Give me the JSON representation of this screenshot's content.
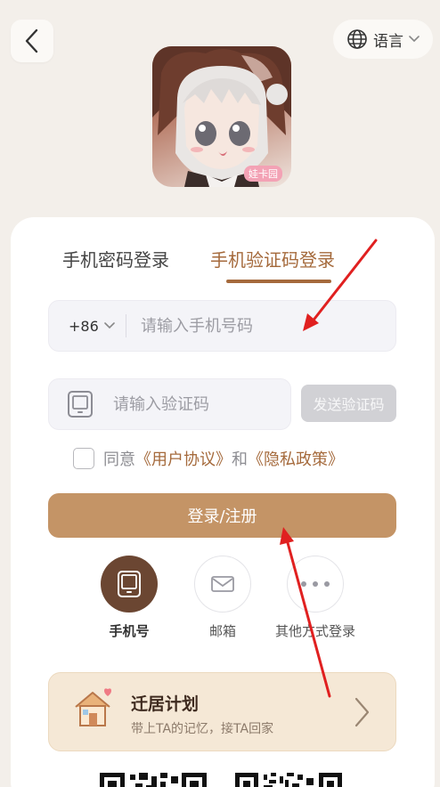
{
  "header": {
    "language_label": "语言"
  },
  "avatar": {
    "watermark": "娃卡园"
  },
  "tabs": [
    {
      "label": "手机密码登录",
      "active": false
    },
    {
      "label": "手机验证码登录",
      "active": true
    }
  ],
  "phone": {
    "country_code": "+86",
    "placeholder": "请输入手机号码",
    "value": ""
  },
  "code": {
    "placeholder": "请输入验证码",
    "value": "",
    "send_label": "发送验证码"
  },
  "agreement": {
    "prefix": "同意",
    "user_agreement": "《用户协议》",
    "conjunction": "和",
    "privacy_policy": "《隐私政策》",
    "checked": false
  },
  "login_button": "登录/注册",
  "alt_methods": [
    {
      "label": "手机号",
      "icon": "phone-icon",
      "active": true
    },
    {
      "label": "邮箱",
      "icon": "mail-icon",
      "active": false
    },
    {
      "label": "其他方式登录",
      "icon": "more-icon",
      "active": false
    }
  ],
  "move_plan": {
    "title": "迁居计划",
    "subtitle": "带上TA的记忆，接TA回家",
    "icon": "house-icon"
  },
  "colors": {
    "accent": "#a56a3c",
    "primary_button": "#c49466",
    "background": "#f3efea",
    "active_method": "#6b4632",
    "annotation_arrow": "#e02020"
  }
}
